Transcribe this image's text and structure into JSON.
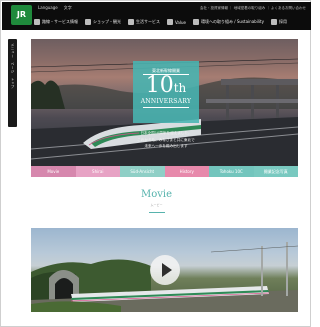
{
  "header": {
    "logo": "JR",
    "row1": [
      "Language",
      "文字"
    ],
    "right_links": "会社・投資家情報 ｜ 地域密着の取り組み ｜ よくあるお問い合わせ",
    "nav": [
      {
        "icon": "train-icon",
        "label": "路線・サービス情報"
      },
      {
        "icon": "shop-icon",
        "label": "ショップ・観光"
      },
      {
        "icon": "service-icon",
        "label": "生活サービス"
      },
      {
        "icon": "value-icon",
        "label": "Value"
      },
      {
        "icon": "leaf-icon",
        "label": "環境への取り組み / Sustainability"
      },
      {
        "icon": "book-icon",
        "label": "採用"
      }
    ]
  },
  "sidetab": {
    "label": "メニュー　ページ　トップ"
  },
  "hero": {
    "badge_top": "東北新幹線開業",
    "badge_number": "10",
    "badge_suffix": "th",
    "badge_sub": "ANNIVERSARY",
    "message": [
      "日本全国10周年を迎えました。",
      "これからも、みなさまと共に東北で",
      "未来へ一歩を踏み出します"
    ]
  },
  "tabs": [
    {
      "label": "Movie",
      "color": "#d687ad"
    },
    {
      "label": "Shirai",
      "color": "#e7a2c4"
    },
    {
      "label": "Süd-Ansicht",
      "color": "#8fcfc6"
    },
    {
      "label": "History",
      "color": "#e789ab"
    },
    {
      "label": "Tohoku 10C",
      "color": "#73c5bd"
    },
    {
      "label": "開業記念写真",
      "color": "#79c9c0"
    }
  ],
  "movie": {
    "title": "Movie",
    "subtitle": "ムービー"
  },
  "colors": {
    "accent": "#57b3ad",
    "header_bg": "#0c0c0c"
  }
}
